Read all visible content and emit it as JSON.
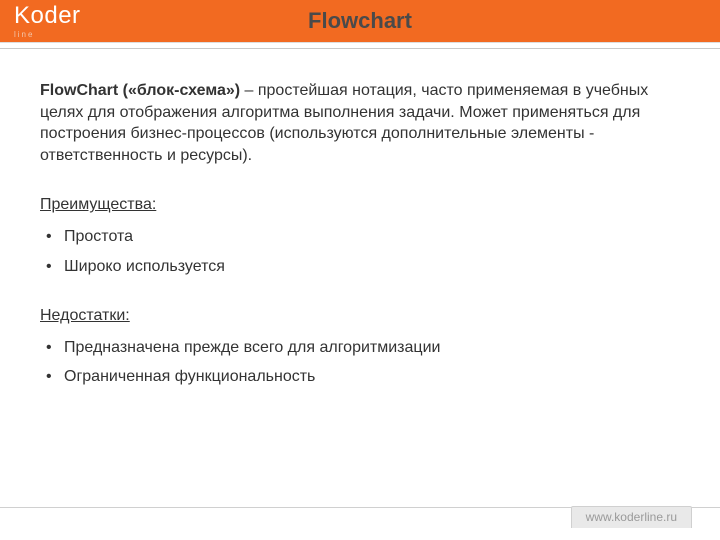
{
  "brand": {
    "name": "Koder",
    "sub": "line"
  },
  "title": "Flowchart",
  "intro": {
    "lead": "FlowChart («блок-схема»)",
    "rest": " – простейшая нотация, часто применяемая в учебных целях для отображения алгоритма выполнения  задачи. Может применяться для построения бизнес-процессов (используются дополнительные элементы - ответственность и ресурсы)."
  },
  "advantages": {
    "label": "Преимущества:",
    "items": [
      "Простота",
      "Широко используется"
    ]
  },
  "disadvantages": {
    "label": "Недостатки:",
    "items": [
      "Предназначена прежде всего для алгоритмизации",
      "Ограниченная функциональность"
    ]
  },
  "footer": {
    "url": "www.koderline.ru"
  }
}
